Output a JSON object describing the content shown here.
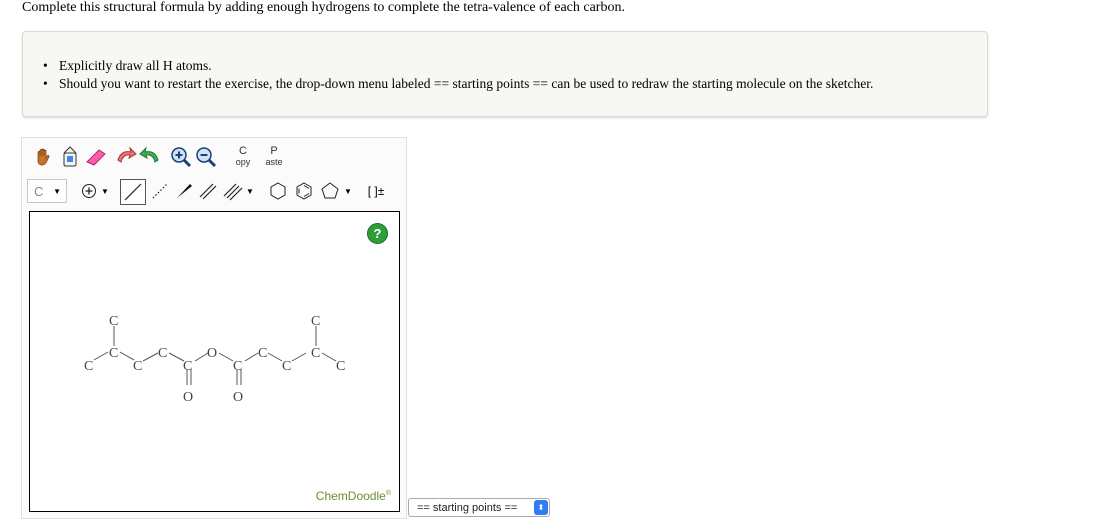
{
  "question": "Complete this structural formula by adding enough hydrogens to complete the tetra-valence of each carbon.",
  "instructions": [
    "Explicitly draw all H atoms.",
    "Should you want to restart the exercise, the drop-down menu labeled == starting points == can be used to redraw the starting molecule on the sketcher."
  ],
  "toolbar": {
    "copy_top": "C",
    "copy_bottom": "opy",
    "paste_top": "P",
    "paste_bottom": "aste",
    "element_label": "C",
    "charge_label": "[ ]±"
  },
  "canvas": {
    "help_label": "?",
    "brand": "ChemDoodle",
    "brand_mark": "®"
  },
  "molecule": {
    "atoms": [
      "C",
      "C",
      "C",
      "C",
      "C",
      "C",
      "O",
      "O",
      "C",
      "C",
      "C",
      "C",
      "C",
      "C",
      "C",
      "O"
    ]
  },
  "starting_points": {
    "selected": "== starting points ==",
    "arrow": "⬍"
  }
}
